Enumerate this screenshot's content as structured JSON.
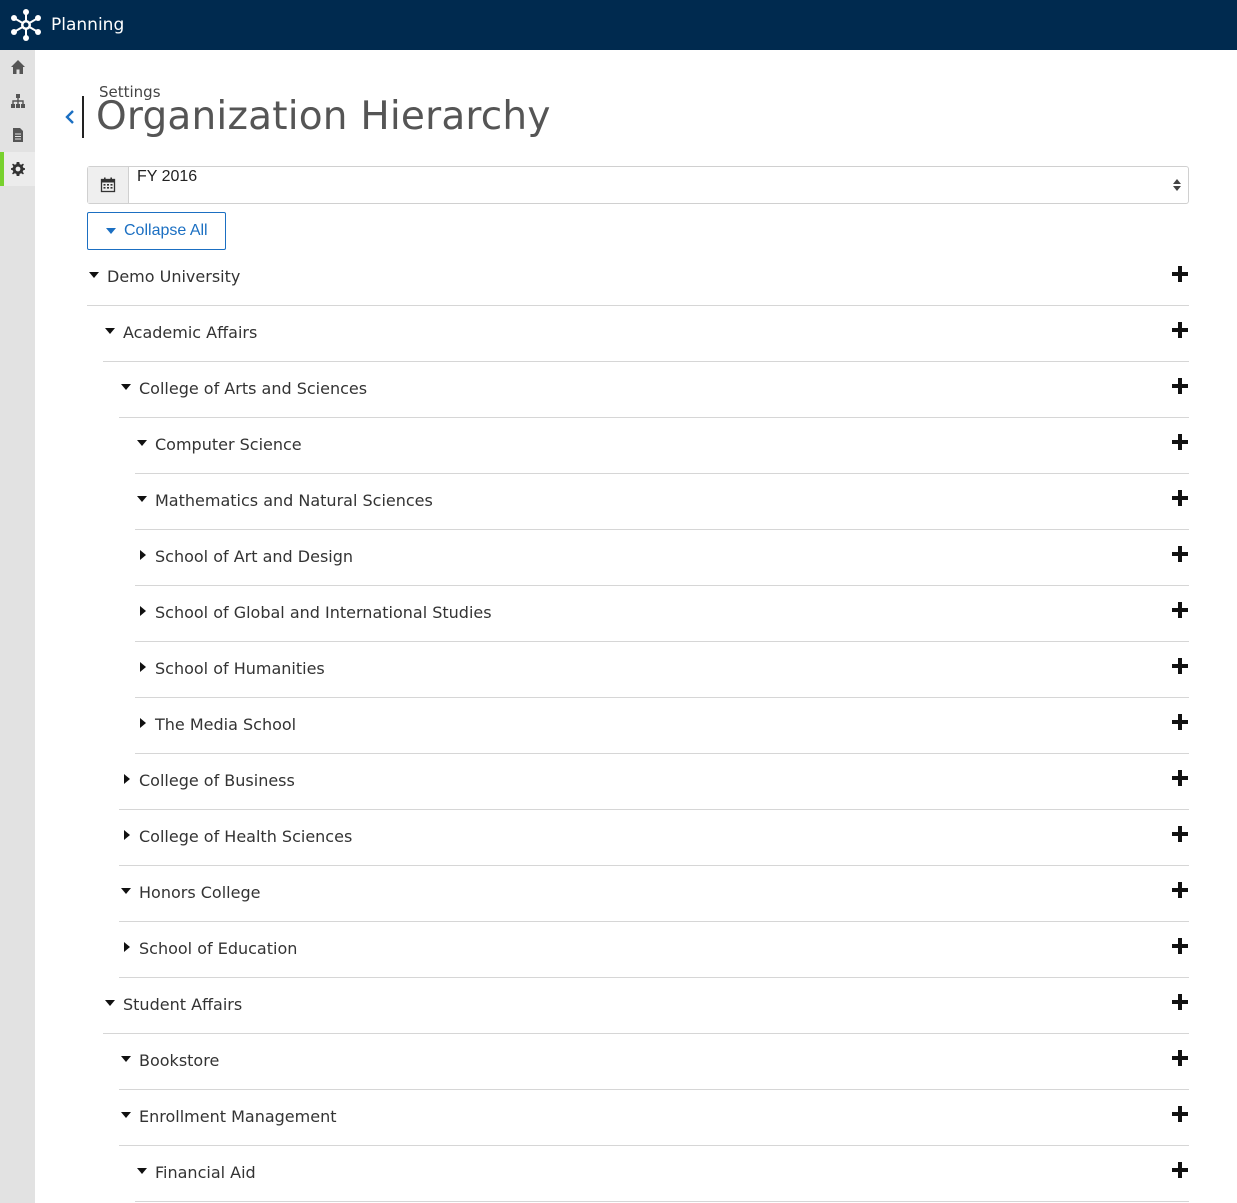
{
  "app": {
    "title": "Planning"
  },
  "sidebar": {
    "items": [
      {
        "name": "home",
        "icon": "home-icon",
        "active": false
      },
      {
        "name": "hierarchy",
        "icon": "sitemap-icon",
        "active": false
      },
      {
        "name": "documents",
        "icon": "document-icon",
        "active": false
      },
      {
        "name": "settings",
        "icon": "gear-icon",
        "active": true
      }
    ]
  },
  "header": {
    "breadcrumb": "Settings",
    "title": "Organization Hierarchy"
  },
  "fiscal_year": {
    "selected": "FY 2016"
  },
  "toolbar": {
    "collapse_label": "Collapse All"
  },
  "tree": [
    {
      "label": "Demo University",
      "level": 0,
      "expanded": true
    },
    {
      "label": "Academic Affairs",
      "level": 1,
      "expanded": true
    },
    {
      "label": "College of Arts and Sciences",
      "level": 2,
      "expanded": true
    },
    {
      "label": "Computer Science",
      "level": 3,
      "expanded": true
    },
    {
      "label": "Mathematics and Natural Sciences",
      "level": 3,
      "expanded": true
    },
    {
      "label": "School of Art and Design",
      "level": 3,
      "expanded": false
    },
    {
      "label": "School of Global and International Studies",
      "level": 3,
      "expanded": false
    },
    {
      "label": "School of Humanities",
      "level": 3,
      "expanded": false
    },
    {
      "label": "The Media School",
      "level": 3,
      "expanded": false
    },
    {
      "label": "College of Business",
      "level": 2,
      "expanded": false
    },
    {
      "label": "College of Health Sciences",
      "level": 2,
      "expanded": false
    },
    {
      "label": "Honors College",
      "level": 2,
      "expanded": true
    },
    {
      "label": "School of Education",
      "level": 2,
      "expanded": false
    },
    {
      "label": "Student Affairs",
      "level": 1,
      "expanded": true
    },
    {
      "label": "Bookstore",
      "level": 2,
      "expanded": true
    },
    {
      "label": "Enrollment Management",
      "level": 2,
      "expanded": true
    },
    {
      "label": "Financial Aid",
      "level": 3,
      "expanded": true
    }
  ],
  "colors": {
    "topbar": "#002a4f",
    "accent": "#1b6fc2",
    "active_indicator": "#78d12e"
  }
}
